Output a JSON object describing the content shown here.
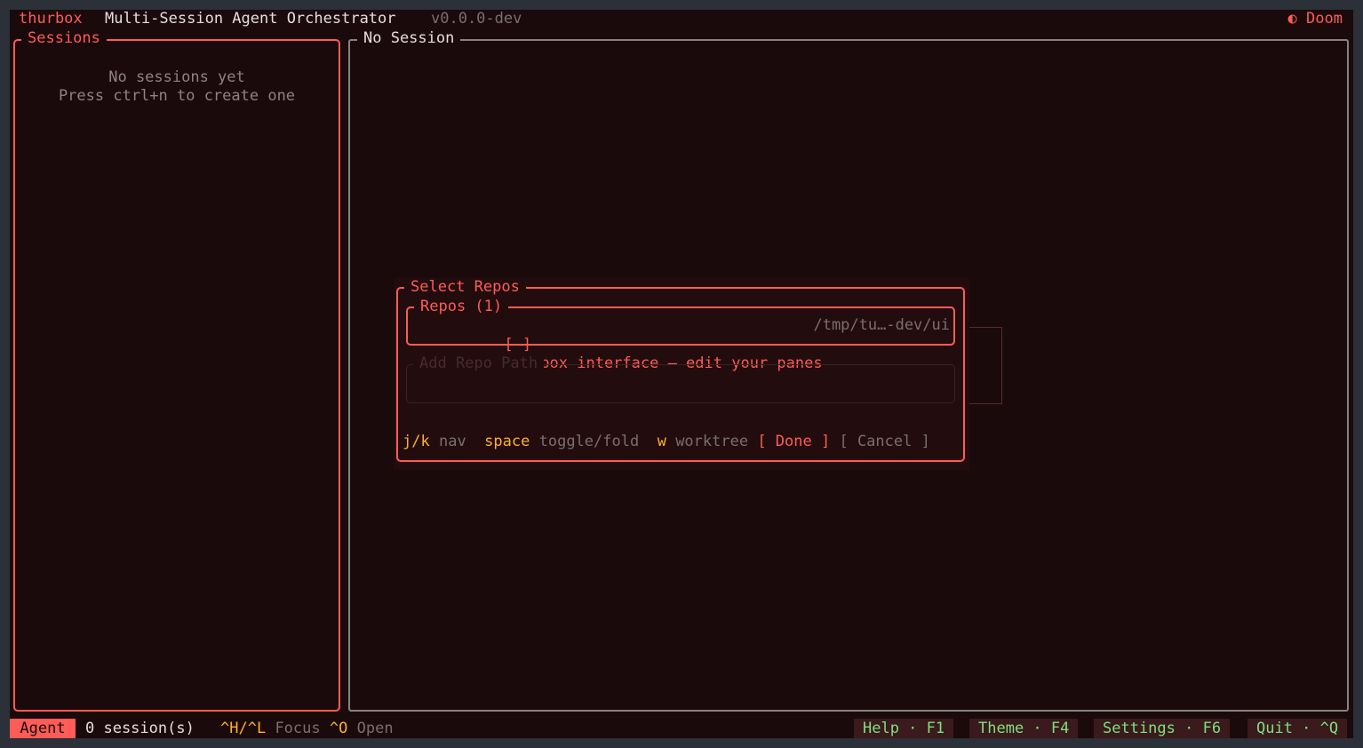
{
  "header": {
    "app_name": "thurbox",
    "subtitle": "Multi-Session Agent Orchestrator",
    "version": "v0.0.0-dev",
    "theme_glyph": "◐",
    "theme_name": "Doom"
  },
  "sessions_panel": {
    "title": "Sessions",
    "empty_line1": "No sessions yet",
    "empty_line2": "Press ctrl+n to create one"
  },
  "main_panel": {
    "title": "No Session"
  },
  "dialog": {
    "title": "Select Repos",
    "repos_title": "Repos (1)",
    "repo": {
      "checkbox": "[ ]",
      "name": "Thurbox interface — edit your panes",
      "path": "/tmp/tu…-dev/ui"
    },
    "add_path_label": "Add Repo Path",
    "hints": [
      {
        "key": "j/k",
        "label": "nav"
      },
      {
        "key": "space",
        "label": "toggle/fold"
      },
      {
        "key": "w",
        "label": "worktree"
      }
    ],
    "done_label": "[ Done ]",
    "cancel_label": "[ Cancel ]"
  },
  "statusbar": {
    "mode": "Agent",
    "count": "0 session(s)",
    "focus_key": "^H/^L",
    "focus_label": "Focus",
    "open_key": "^O",
    "open_label": "Open",
    "buttons": {
      "help": "Help · F1",
      "theme": "Theme · F4",
      "settings": "Settings · F6",
      "quit": "Quit · ^Q"
    }
  },
  "colors": {
    "background": "#1a0a0b",
    "accent": "#ff5c57",
    "key_highlight": "#ffb02e",
    "status_green": "#7ee07e"
  }
}
